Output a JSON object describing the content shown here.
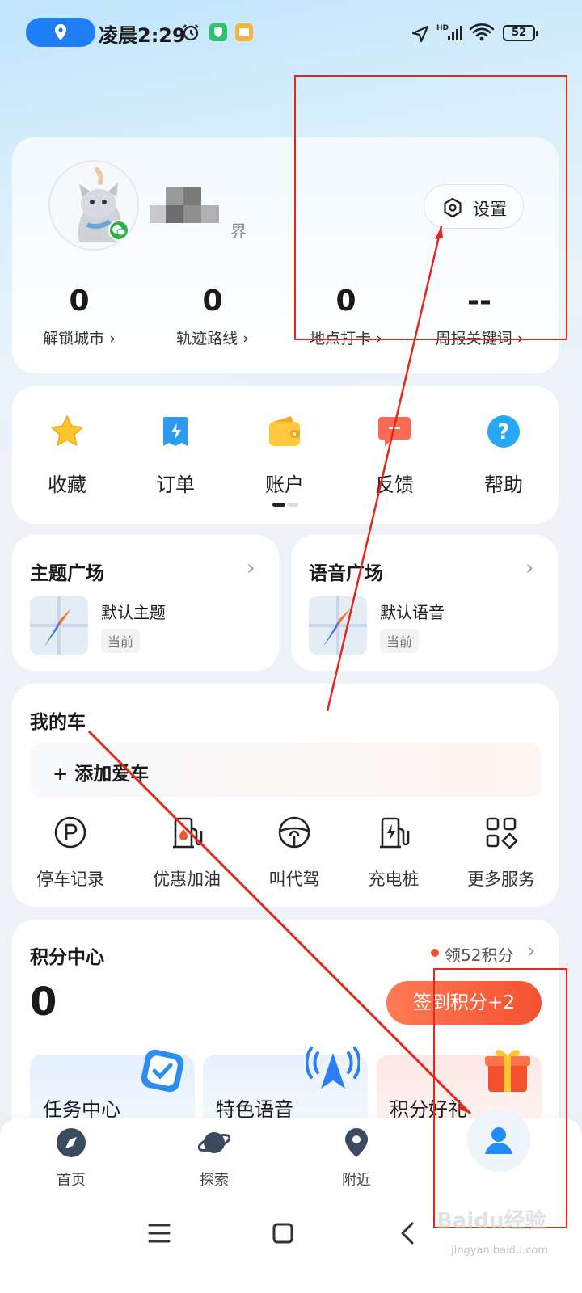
{
  "status_bar": {
    "time": "凌晨2:29",
    "battery": "52"
  },
  "profile": {
    "name_suffix": "界",
    "settings_label": "设置",
    "stats": [
      {
        "value": "0",
        "label": "解锁城市 ›"
      },
      {
        "value": "0",
        "label": "轨迹路线 ›"
      },
      {
        "value": "0",
        "label": "地点打卡 ›"
      },
      {
        "value": "--",
        "label": "周报关键词 ›"
      }
    ]
  },
  "quick_actions": [
    {
      "label": "收藏",
      "icon": "star-icon"
    },
    {
      "label": "订单",
      "icon": "order-icon"
    },
    {
      "label": "账户",
      "icon": "wallet-icon"
    },
    {
      "label": "反馈",
      "icon": "feedback-icon"
    },
    {
      "label": "帮助",
      "icon": "help-icon"
    }
  ],
  "theme_card": {
    "title": "主题广场",
    "item": "默认主题",
    "tag": "当前"
  },
  "voice_card": {
    "title": "语音广场",
    "item": "默认语音",
    "tag": "当前"
  },
  "my_car": {
    "title": "我的车",
    "add_label": "+ 添加爱车",
    "services": [
      {
        "label": "停车记录",
        "icon": "parking-icon"
      },
      {
        "label": "优惠加油",
        "icon": "fuel-icon"
      },
      {
        "label": "叫代驾",
        "icon": "steering-wheel-icon"
      },
      {
        "label": "充电桩",
        "icon": "charging-icon"
      },
      {
        "label": "更多服务",
        "icon": "grid-icon"
      }
    ]
  },
  "points": {
    "title": "积分中心",
    "claim_label": "领52积分",
    "value": "0",
    "checkin_label": "签到积分+2",
    "tiles": [
      "任务中心",
      "特色语音",
      "积分好礼"
    ]
  },
  "bottom_nav": [
    {
      "label": "首页",
      "icon": "compass-icon"
    },
    {
      "label": "探索",
      "icon": "planet-icon"
    },
    {
      "label": "附近",
      "icon": "location-pin-icon"
    },
    {
      "label": "",
      "icon": "user-icon"
    }
  ],
  "watermark": {
    "logo": "Baidu经验",
    "url": "jingyan.baidu.com"
  },
  "colors": {
    "accent": "#1f7ef5",
    "orange": "#f5512f",
    "annotation": "#e0281c"
  }
}
